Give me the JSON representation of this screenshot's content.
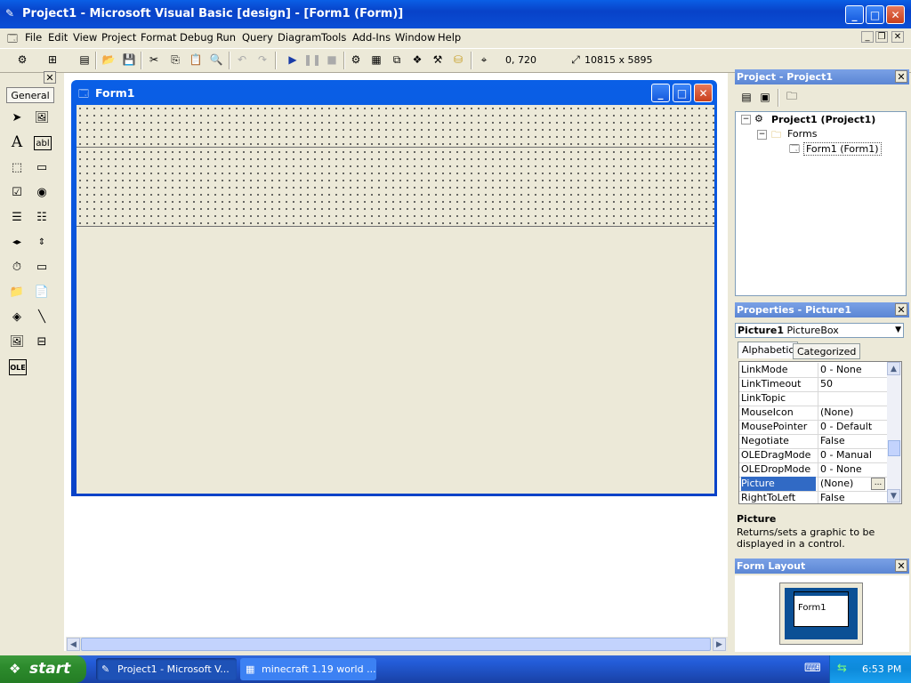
{
  "window": {
    "title": "Project1 - Microsoft Visual Basic [design] - [Form1 (Form)]",
    "min": "_",
    "max": "□",
    "close": "✕"
  },
  "menu": [
    "File",
    "Edit",
    "View",
    "Project",
    "Format",
    "Debug",
    "Run",
    "Query",
    "Diagram",
    "Tools",
    "Add-Ins",
    "Window",
    "Help"
  ],
  "toolbar": {
    "position": "0, 720",
    "size": "10815 x 5895"
  },
  "toolbox": {
    "tab": "General",
    "close": "✕"
  },
  "form1": {
    "title": "Form1"
  },
  "project": {
    "title": "Project - Project1",
    "root": "Project1 (Project1)",
    "folder": "Forms",
    "item": "Form1 (Form1)"
  },
  "properties": {
    "title": "Properties - Picture1",
    "object_name": "Picture1",
    "object_type": "PictureBox",
    "tabs": [
      "Alphabetic",
      "Categorized"
    ],
    "rows": [
      {
        "name": "LinkMode",
        "value": "0 - None"
      },
      {
        "name": "LinkTimeout",
        "value": "50"
      },
      {
        "name": "LinkTopic",
        "value": ""
      },
      {
        "name": "MouseIcon",
        "value": "(None)"
      },
      {
        "name": "MousePointer",
        "value": "0 - Default"
      },
      {
        "name": "Negotiate",
        "value": "False"
      },
      {
        "name": "OLEDragMode",
        "value": "0 - Manual"
      },
      {
        "name": "OLEDropMode",
        "value": "0 - None"
      },
      {
        "name": "Picture",
        "value": "(None)"
      },
      {
        "name": "RightToLeft",
        "value": "False"
      }
    ],
    "selected": "Picture",
    "desc_title": "Picture",
    "desc_text": "Returns/sets a graphic to be displayed in a control."
  },
  "form_layout": {
    "title": "Form Layout",
    "label": "Form1"
  },
  "taskbar": {
    "start": "start",
    "tasks": [
      "Project1 - Microsoft V...",
      "minecraft 1.19 world ..."
    ],
    "time": "6:53 PM"
  }
}
